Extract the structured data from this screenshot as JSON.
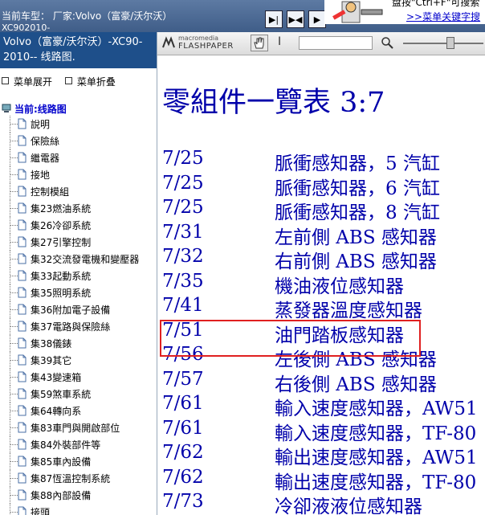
{
  "header": {
    "vehicle_line1": "当前车型： 厂家:Volvo（富豪/沃尔沃）",
    "vehicle_line2": "XC902010-",
    "tip_line1": "盘按\"Ctrl+F\"可搜索",
    "tip_link": ">>菜单关键字搜"
  },
  "sidebar": {
    "title": "Volvo（富豪/沃尔沃）-XC90-2010-- 线路图.",
    "expand_label": "菜单展开",
    "collapse_label": "菜单折叠",
    "root_label": "当前:线路图",
    "items": [
      "說明",
      "保險絲",
      "繼電器",
      "接地",
      "控制模組",
      "集23燃油系統",
      "集26冷卻系統",
      "集27引擎控制",
      "集32交流發電機和變壓器",
      "集33起動系統",
      "集35照明系統",
      "集36附加電子設備",
      "集37電路與保險絲",
      "集38儀錶",
      "集39其它",
      "集43變速箱",
      "集59煞車系統",
      "集64轉向系",
      "集83車門與開啟部位",
      "集84外裝部件等",
      "集85車內設備",
      "集87恆溫控制系統",
      "集88內部設備",
      "接頭"
    ]
  },
  "toolbar": {
    "brand_top": "macromedia",
    "brand_name": "FLASHPAPER"
  },
  "document": {
    "heading": "零組件一覽表 3:7",
    "rows": [
      {
        "page": "7/25",
        "name": "脈衝感知器，5 汽缸"
      },
      {
        "page": "7/25",
        "name": "脈衝感知器，6 汽缸"
      },
      {
        "page": "7/25",
        "name": "脈衝感知器，8 汽缸"
      },
      {
        "page": "7/31",
        "name": "左前側 ABS 感知器"
      },
      {
        "page": "7/32",
        "name": "右前側 ABS 感知器"
      },
      {
        "page": "7/35",
        "name": "機油液位感知器"
      },
      {
        "page": "7/41",
        "name": "蒸發器溫度感知器"
      },
      {
        "page": "7/51",
        "name": "油門踏板感知器"
      },
      {
        "page": "7/56",
        "name": "左後側 ABS 感知器"
      },
      {
        "page": "7/57",
        "name": "右後側 ABS 感知器"
      },
      {
        "page": "7/61",
        "name": "輸入速度感知器，AW51"
      },
      {
        "page": "7/61",
        "name": "輸入速度感知器，TF-80"
      },
      {
        "page": "7/62",
        "name": "輸出速度感知器，AW51"
      },
      {
        "page": "7/62",
        "name": "輸出速度感知器，TF-80"
      },
      {
        "page": "7/73",
        "name": "冷卻液液位感知器"
      }
    ]
  },
  "colors": {
    "doc_text": "#0000aa",
    "highlight_border": "#e02020",
    "sidebar_title_bg": "#1e4f8a"
  }
}
